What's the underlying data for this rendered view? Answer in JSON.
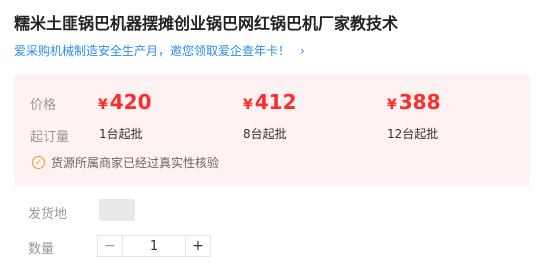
{
  "product": {
    "title": "糯米土匪锅巴机器摆摊创业锅巴网红锅巴机厂家教技术",
    "promo_text": "爱采购机械制造安全生产月，邀您领取爱企查年卡！",
    "promo_chevron": "›"
  },
  "pricing": {
    "price_label": "价格",
    "moq_label": "起订量",
    "currency": "¥",
    "tiers": [
      {
        "price": "420",
        "moq": "1台起批"
      },
      {
        "price": "412",
        "moq": "8台起批"
      },
      {
        "price": "388",
        "moq": "12台起批"
      }
    ],
    "verify_text": "货源所属商家已经过真实性核验",
    "accent_color": "#ff2c2c"
  },
  "shipping": {
    "label": "发货地"
  },
  "quantity": {
    "label": "数量",
    "minus": "−",
    "plus": "+",
    "value": "1"
  }
}
